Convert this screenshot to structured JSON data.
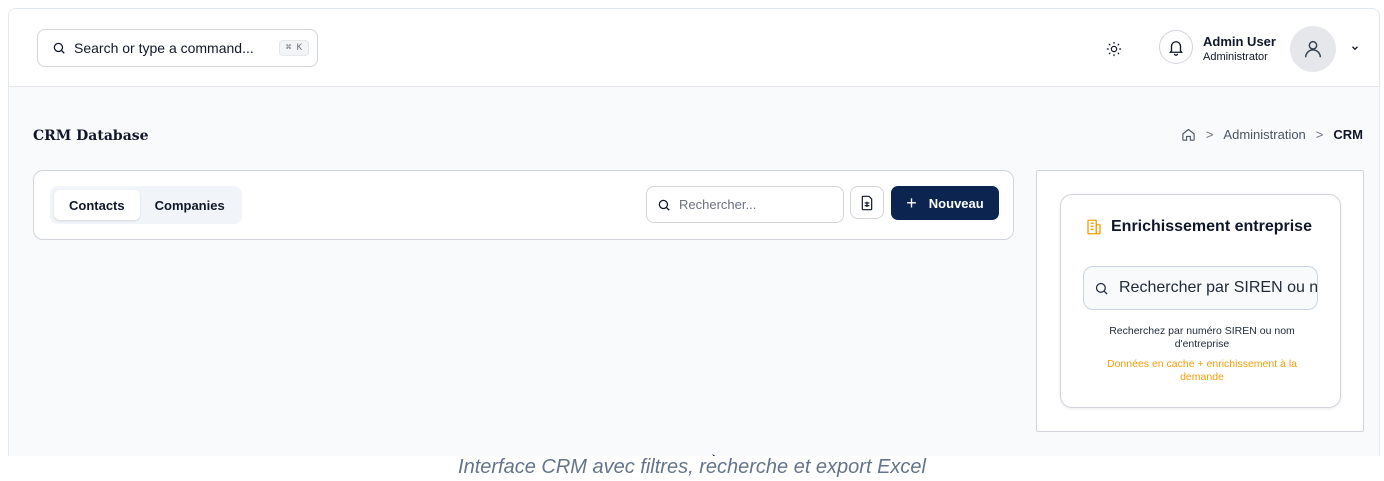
{
  "topbar": {
    "search_placeholder": "Search or type a command...",
    "shortcut": "⌘ K",
    "user_name": "Admin User",
    "user_role": "Administrator"
  },
  "page": {
    "title": "CRM Database",
    "breadcrumb": [
      "Administration",
      "CRM"
    ]
  },
  "toolbar": {
    "tabs": [
      "Contacts",
      "Companies"
    ],
    "active_tab": "Contacts",
    "search_placeholder": "Rechercher...",
    "new_label": "Nouveau"
  },
  "enrichment": {
    "title": "Enrichissement entreprise",
    "search_placeholder": "Rechercher par SIREN ou nom",
    "help": "Recherchez par numéro SIREN ou nom d'entreprise",
    "note": "Données en cache + enrichissement à la demande"
  },
  "caption": "Interface CRM avec filtres, recherche et export Excel",
  "colors": {
    "primary": "#0b2550",
    "accent": "#f59e0b",
    "border": "#d1d5db"
  },
  "icons": {
    "search": "search-icon",
    "theme": "sun-icon",
    "notifications": "bell-icon",
    "avatar": "user-icon",
    "menu": "chevron-down-icon",
    "home": "home-icon",
    "export": "file-spreadsheet-icon",
    "building": "building-icon"
  }
}
